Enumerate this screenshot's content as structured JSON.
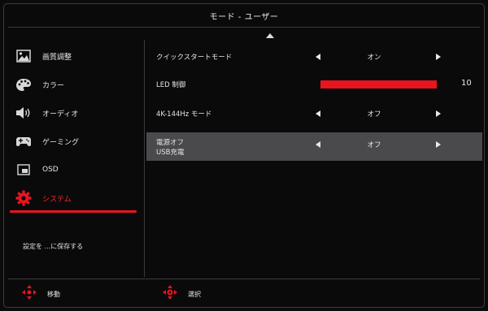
{
  "header": {
    "title": "モード - ユーザー"
  },
  "sidebar": {
    "items": [
      {
        "label": "画質調整",
        "icon": "picture-icon"
      },
      {
        "label": "カラー",
        "icon": "palette-icon"
      },
      {
        "label": "オーディオ",
        "icon": "speaker-icon"
      },
      {
        "label": "ゲーミング",
        "icon": "gamepad-icon"
      },
      {
        "label": "OSD",
        "icon": "osd-window-icon"
      },
      {
        "label": "システム",
        "icon": "gear-icon",
        "active": true
      }
    ],
    "save_text": "設定を ...に保存する"
  },
  "settings": {
    "quick_start": {
      "label": "クイックスタートモード",
      "value": "オン"
    },
    "led": {
      "label": "LED 制御",
      "value": "10",
      "level_fraction": 1.0
    },
    "hz_mode": {
      "label": "4K-144Hz モード",
      "value": "オフ"
    },
    "usb_power": {
      "label_line1": "電源オフ",
      "label_line2": "USB充電",
      "value": "オフ",
      "selected": true
    }
  },
  "footer": {
    "move_label": "移動",
    "select_label": "選択"
  },
  "colors": {
    "accent": "#e8141e",
    "active_text": "#ff2a2a",
    "selected_row": "#4a4a4c"
  }
}
